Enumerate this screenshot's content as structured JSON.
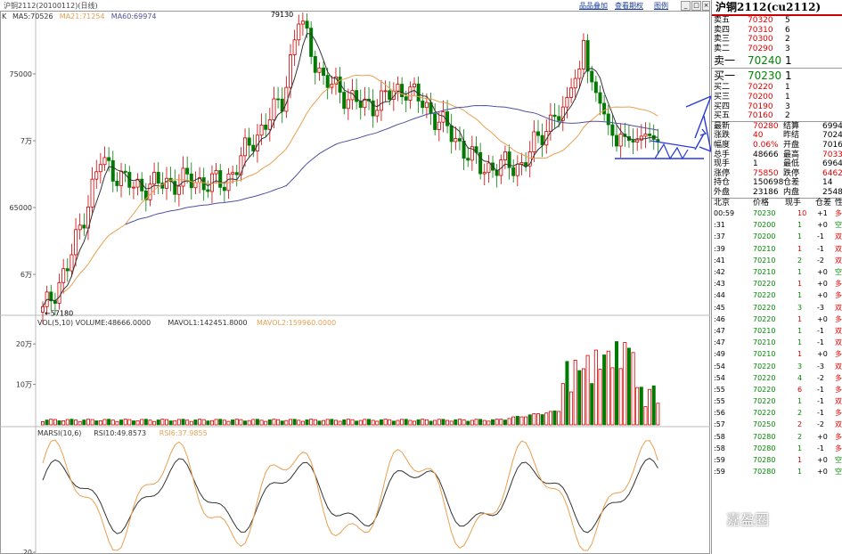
{
  "topbar": {
    "title": "沪铜2112(20100112)(日线)",
    "buttons": [
      "品品叠加",
      "查看期权",
      "图例"
    ]
  },
  "colors": {
    "up": "#d00000",
    "down": "#007a00",
    "ma5": "#333333",
    "ma21": "#e8a050",
    "ma60": "#5050a0",
    "annotation": "#2a3ad8"
  },
  "chart_data": [
    {
      "type": "candlestick",
      "legend": [
        {
          "name": "MA5:70526",
          "color": "#333333"
        },
        {
          "name": "MA21:71254",
          "color": "#e8a050"
        },
        {
          "name": "MA60:69974",
          "color": "#5050a0"
        }
      ],
      "legend_prefix": "K",
      "y_ticks": [
        {
          "label": "75000",
          "value": 75000
        },
        {
          "label": "7万",
          "value": 70000
        },
        {
          "label": "65000",
          "value": 65000
        },
        {
          "label": "6万",
          "value": 60000
        }
      ],
      "ylim": [
        57000,
        79600
      ],
      "annotations": [
        {
          "label": "79130",
          "value": 79130
        },
        {
          "label": "57180",
          "value": 57180
        }
      ]
    },
    {
      "type": "bar",
      "legend": [
        {
          "name": "VOL(5,10) VOLUME:48666.0000",
          "color": "#333333"
        },
        {
          "name": "MAVOL1:142451.8000",
          "color": "#333333"
        },
        {
          "name": "MAVOL2:159960.0000",
          "color": "#e8a050"
        }
      ],
      "y_ticks": [
        {
          "label": "20万",
          "value": 200000
        },
        {
          "label": "10万",
          "value": 100000
        }
      ],
      "ylim": [
        0,
        240000
      ]
    },
    {
      "type": "line",
      "legend": [
        {
          "name": "MARSI(10,6)",
          "color": "#333333"
        },
        {
          "name": "RSI10:49.8573",
          "color": "#333333"
        },
        {
          "name": "RSI6:37.9855",
          "color": "#e8a050"
        }
      ],
      "y_ticks": [
        {
          "label": "20",
          "value": 20
        }
      ],
      "ylim": [
        20,
        85
      ]
    }
  ],
  "panel": {
    "title": "沪铜2112(cu2112)",
    "asks": [
      {
        "label": "卖五",
        "price": "70320",
        "vol": "5"
      },
      {
        "label": "卖四",
        "price": "70310",
        "vol": "6"
      },
      {
        "label": "卖三",
        "price": "70300",
        "vol": "2"
      },
      {
        "label": "卖二",
        "price": "70290",
        "vol": "3"
      },
      {
        "label": "卖一",
        "price": "70240",
        "vol": "1"
      }
    ],
    "bids": [
      {
        "label": "买一",
        "price": "70230",
        "vol": "1"
      },
      {
        "label": "买二",
        "price": "70220",
        "vol": "1"
      },
      {
        "label": "买三",
        "price": "70200",
        "vol": "1"
      },
      {
        "label": "买四",
        "price": "70190",
        "vol": "3"
      },
      {
        "label": "买五",
        "price": "70160",
        "vol": "2"
      }
    ],
    "stats": [
      {
        "l1": "最新",
        "v1": "70280",
        "l2": "结算",
        "v2": "6994"
      },
      {
        "l1": "涨跌",
        "v1": "40",
        "l2": "昨结",
        "v2": "7024"
      },
      {
        "l1": "幅度",
        "v1": "0.06%",
        "l2": "开盘",
        "v2": "7016"
      },
      {
        "l1": "总手",
        "v1": "48666",
        "l2": "最高",
        "v2": "7033"
      },
      {
        "l1": "现手",
        "v1": "1",
        "l2": "最低",
        "v2": "6964"
      },
      {
        "l1": "涨停",
        "v1": "75850",
        "l2": "跌停",
        "v2": "6462"
      },
      {
        "l1": "持仓",
        "v1": "150698",
        "l2": "仓差",
        "v2": "14"
      },
      {
        "l1": "外盘",
        "v1": "23186",
        "l2": "内盘",
        "v2": "2548"
      }
    ],
    "tick_header": [
      "北京",
      "价格",
      "现手",
      "仓差",
      "性"
    ],
    "ticks": [
      {
        "t": "00:59",
        "p": "70230",
        "v": "10",
        "d": "+1",
        "n": "多"
      },
      {
        "t": ":31",
        "p": "70200",
        "v": "1",
        "d": "+0",
        "n": "空"
      },
      {
        "t": ":37",
        "p": "70200",
        "v": "1",
        "d": "-1",
        "n": "双"
      },
      {
        "t": ":39",
        "p": "70210",
        "v": "1",
        "d": "-1",
        "n": "双"
      },
      {
        "t": ":41",
        "p": "70210",
        "v": "2",
        "d": "-2",
        "n": "双"
      },
      {
        "t": ":42",
        "p": "70210",
        "v": "1",
        "d": "+0",
        "n": "空"
      },
      {
        "t": ":43",
        "p": "70220",
        "v": "1",
        "d": "+0",
        "n": "多"
      },
      {
        "t": ":44",
        "p": "70220",
        "v": "1",
        "d": "+0",
        "n": "多"
      },
      {
        "t": ":45",
        "p": "70220",
        "v": "3",
        "d": "-3",
        "n": "双"
      },
      {
        "t": ":46",
        "p": "70220",
        "v": "1",
        "d": "+0",
        "n": "多"
      },
      {
        "t": ":47",
        "p": "70210",
        "v": "1",
        "d": "-1",
        "n": "双"
      },
      {
        "t": ":47",
        "p": "70210",
        "v": "1",
        "d": "-1",
        "n": "双"
      },
      {
        "t": ":49",
        "p": "70210",
        "v": "1",
        "d": "+0",
        "n": "多"
      },
      {
        "t": ":54",
        "p": "70220",
        "v": "3",
        "d": "-3",
        "n": "双"
      },
      {
        "t": ":54",
        "p": "70220",
        "v": "4",
        "d": "-2",
        "n": "多"
      },
      {
        "t": ":55",
        "p": "70220",
        "v": "6",
        "d": "-1",
        "n": "多"
      },
      {
        "t": ":55",
        "p": "70220",
        "v": "1",
        "d": "-1",
        "n": "双"
      },
      {
        "t": ":56",
        "p": "70220",
        "v": "2",
        "d": "-1",
        "n": "多"
      },
      {
        "t": ":57",
        "p": "70250",
        "v": "2",
        "d": "-2",
        "n": "双"
      },
      {
        "t": ":58",
        "p": "70280",
        "v": "2",
        "d": "+0",
        "n": "多"
      },
      {
        "t": ":58",
        "p": "70280",
        "v": "1",
        "d": "-1",
        "n": "多"
      },
      {
        "t": ":59",
        "p": "70280",
        "v": "1",
        "d": "+0",
        "n": "空"
      },
      {
        "t": ":59",
        "p": "70280",
        "v": "1",
        "d": "+0",
        "n": "空"
      }
    ]
  },
  "watermark": "嘉盈圈"
}
